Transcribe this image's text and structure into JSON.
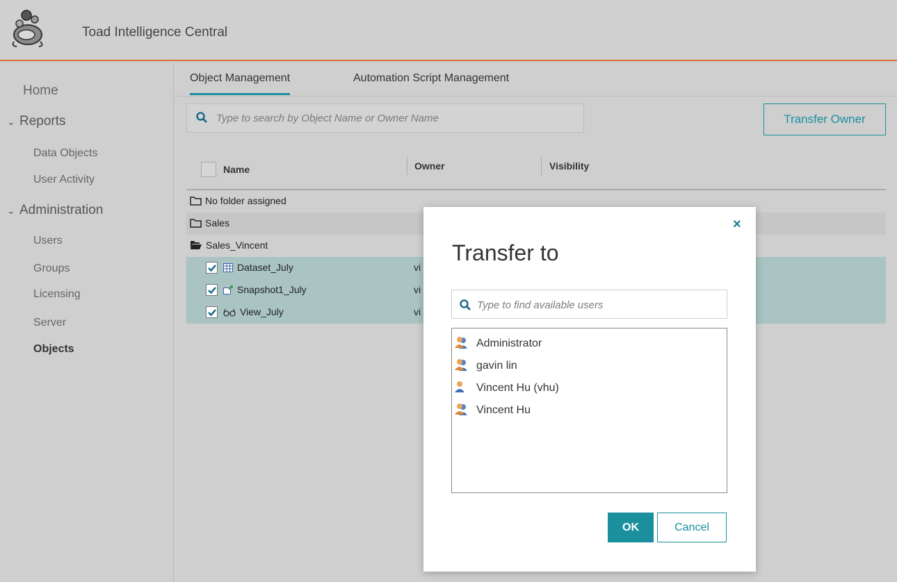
{
  "app": {
    "title": "Toad Intelligence Central"
  },
  "sidebar": {
    "home": "Home",
    "reports": {
      "label": "Reports",
      "items": [
        "Data Objects",
        "User Activity"
      ]
    },
    "administration": {
      "label": "Administration",
      "items": [
        "Users",
        "Groups",
        "Licensing",
        "Server",
        "Objects"
      ]
    }
  },
  "main": {
    "tabs": [
      "Object Management",
      "Automation Script Management"
    ],
    "search_placeholder": "Type to search by Object Name or Owner Name",
    "transfer_owner_label": "Transfer Owner",
    "columns": [
      "Name",
      "Owner",
      "Visibility"
    ],
    "folders": [
      "No folder assigned",
      "Sales",
      "Sales_Vincent"
    ],
    "objects": [
      {
        "name": "Dataset_July",
        "owner": "vi",
        "icon": "dataset-icon"
      },
      {
        "name": "Snapshot1_July",
        "owner": "vi",
        "icon": "snapshot-icon"
      },
      {
        "name": "View_July",
        "owner": "vi",
        "icon": "view-icon"
      }
    ]
  },
  "dialog": {
    "title": "Transfer to",
    "close": "×",
    "search_placeholder": "Type to find available users",
    "users": [
      {
        "name": "Administrator",
        "icon": "user-group-icon"
      },
      {
        "name": "gavin lin",
        "icon": "user-group-icon"
      },
      {
        "name": "Vincent Hu (vhu)",
        "icon": "user-icon"
      },
      {
        "name": "Vincent Hu",
        "icon": "user-group-icon"
      }
    ],
    "ok_label": "OK",
    "cancel_label": "Cancel"
  },
  "colors": {
    "accent": "#1a8f9d",
    "header_line": "#e06b3a",
    "selected_row": "#a9c4c2"
  }
}
